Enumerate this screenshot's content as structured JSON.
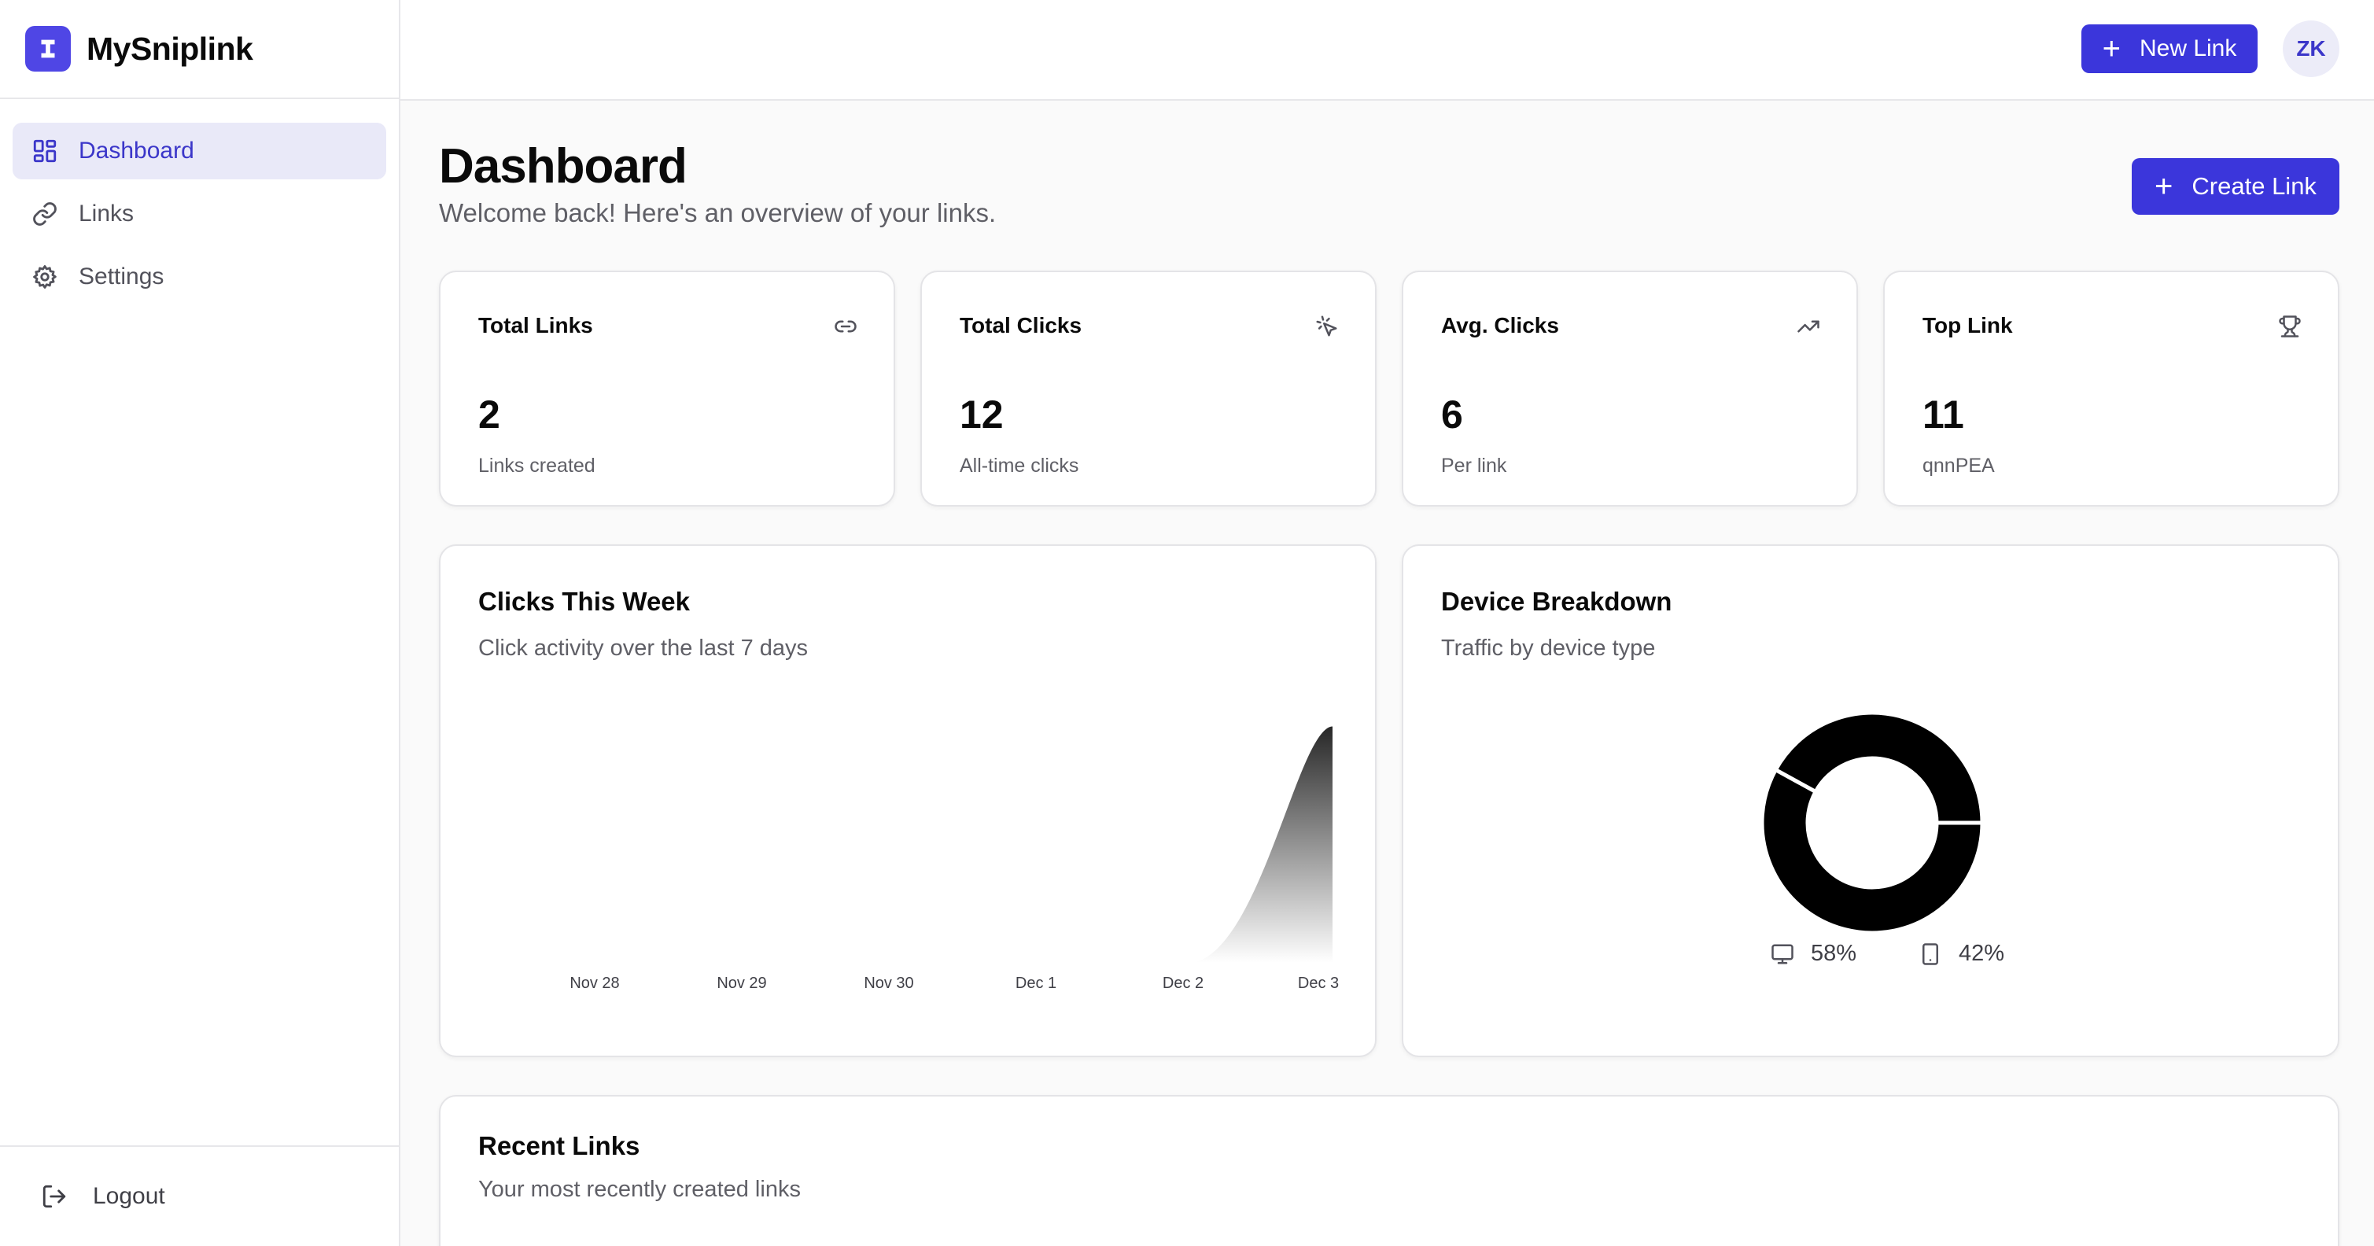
{
  "brand": {
    "name": "MySniplink"
  },
  "sidebar": {
    "items": [
      {
        "label": "Dashboard",
        "icon": "layout-dashboard-icon",
        "active": true
      },
      {
        "label": "Links",
        "icon": "link-icon",
        "active": false
      },
      {
        "label": "Settings",
        "icon": "gear-icon",
        "active": false
      }
    ],
    "logout_label": "Logout"
  },
  "header": {
    "new_link_label": "New Link",
    "avatar_initials": "ZK"
  },
  "page": {
    "title": "Dashboard",
    "subtitle": "Welcome back! Here's an overview of your links.",
    "create_link_label": "Create Link"
  },
  "stats": [
    {
      "title": "Total Links",
      "value": "2",
      "sub": "Links created",
      "icon": "link-icon"
    },
    {
      "title": "Total Clicks",
      "value": "12",
      "sub": "All-time clicks",
      "icon": "pointer-click-icon"
    },
    {
      "title": "Avg. Clicks",
      "value": "6",
      "sub": "Per link",
      "icon": "trending-up-icon"
    },
    {
      "title": "Top Link",
      "value": "11",
      "sub": "qnnPEA",
      "icon": "trophy-icon"
    }
  ],
  "clicks_chart": {
    "title": "Clicks This Week",
    "subtitle": "Click activity over the last 7 days"
  },
  "device_chart": {
    "title": "Device Breakdown",
    "subtitle": "Traffic by device type"
  },
  "recent_links": {
    "title": "Recent Links",
    "subtitle": "Your most recently created links"
  },
  "colors": {
    "accent": "#3b36db",
    "active_nav_bg": "#e9e9f8",
    "chart_fill": "#000000"
  },
  "chart_data": [
    {
      "type": "area",
      "x": [
        "Nov 28",
        "Nov 29",
        "Nov 30",
        "Dec 1",
        "Dec 2",
        "Dec 3"
      ],
      "series": [
        {
          "values": [
            0,
            0,
            0,
            0,
            0,
            12
          ]
        }
      ],
      "title": "Clicks This Week",
      "grid": false
    },
    {
      "type": "pie",
      "categories": [
        "58%",
        "42%"
      ],
      "values": [
        58,
        42
      ],
      "icons": [
        "monitor-icon",
        "smartphone-icon"
      ],
      "title": "Device Breakdown",
      "legend": "bottom"
    }
  ]
}
